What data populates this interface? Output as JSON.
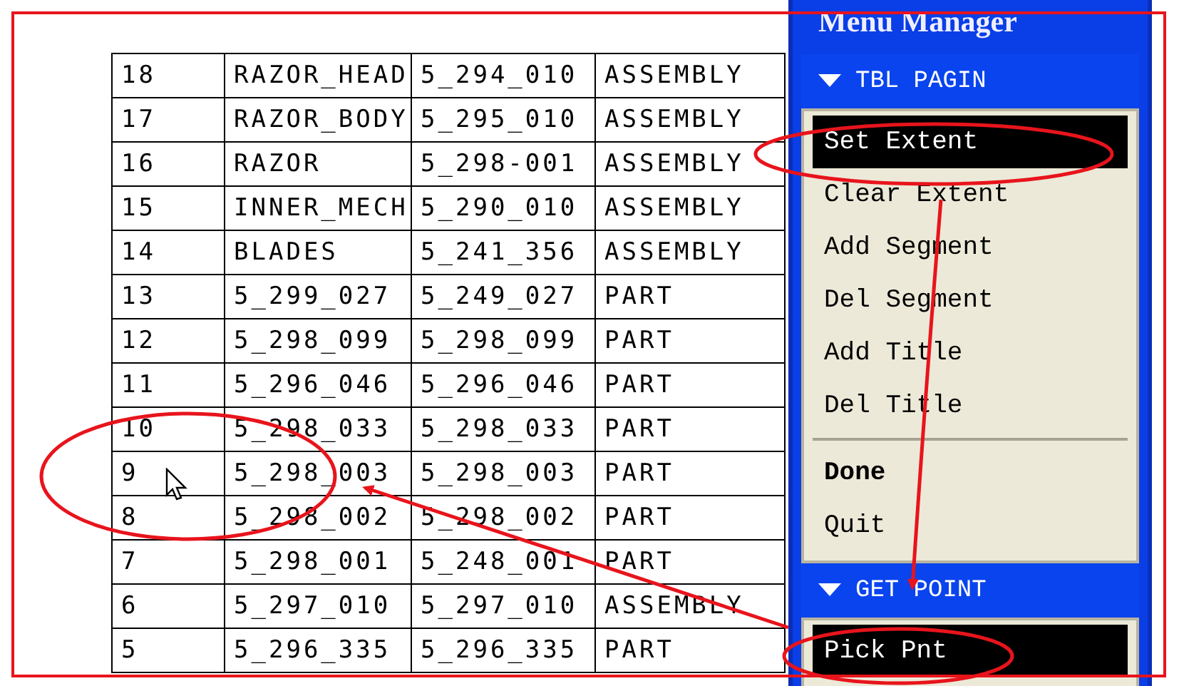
{
  "table": {
    "rows": [
      {
        "cells": [
          "18",
          "RAZOR_HEAD",
          "5_294_010",
          "ASSEMBLY"
        ]
      },
      {
        "cells": [
          "17",
          "RAZOR_BODY",
          "5_295_010",
          "ASSEMBLY"
        ]
      },
      {
        "cells": [
          "16",
          "RAZOR",
          "5_298-001",
          "ASSEMBLY"
        ]
      },
      {
        "cells": [
          "15",
          "INNER_MECH",
          "5_290_010",
          "ASSEMBLY"
        ]
      },
      {
        "cells": [
          "14",
          "BLADES",
          "5_241_356",
          "ASSEMBLY"
        ]
      },
      {
        "cells": [
          "13",
          "5_299_027",
          "5_249_027",
          "PART"
        ]
      },
      {
        "cells": [
          "12",
          "5_298_099",
          "5_298_099",
          "PART"
        ]
      },
      {
        "cells": [
          "11",
          "5_296_046",
          "5_296_046",
          "PART"
        ]
      },
      {
        "cells": [
          "10",
          "5_298_033",
          "5_298_033",
          "PART"
        ]
      },
      {
        "cells": [
          "9",
          "5_298_003",
          "5_298_003",
          "PART"
        ]
      },
      {
        "cells": [
          "8",
          "5_298_002",
          "5_298_002",
          "PART"
        ]
      },
      {
        "cells": [
          "7",
          "5_298_001",
          "5_248_001",
          "PART"
        ]
      },
      {
        "cells": [
          "6",
          "5_297_010",
          "5_297_010",
          "ASSEMBLY"
        ]
      },
      {
        "cells": [
          "5",
          "5_296_335",
          "5_296_335",
          "PART"
        ]
      }
    ]
  },
  "menu_manager": {
    "title": "Menu Manager",
    "sections": [
      {
        "title": "TBL PAGIN",
        "expanded": true,
        "groups": [
          [
            {
              "label": "Set Extent",
              "selected": true,
              "bold": false
            },
            {
              "label": "Clear Extent",
              "selected": false,
              "bold": false
            },
            {
              "label": "Add Segment",
              "selected": false,
              "bold": false
            },
            {
              "label": "Del Segment",
              "selected": false,
              "bold": false
            },
            {
              "label": "Add Title",
              "selected": false,
              "bold": false
            },
            {
              "label": "Del Title",
              "selected": false,
              "bold": false
            }
          ],
          [
            {
              "label": "Done",
              "selected": false,
              "bold": true
            },
            {
              "label": "Quit",
              "selected": false,
              "bold": false
            }
          ]
        ]
      },
      {
        "title": "GET POINT",
        "expanded": true,
        "groups": [
          [
            {
              "label": "Pick Pnt",
              "selected": true,
              "bold": false
            }
          ]
        ]
      }
    ]
  }
}
